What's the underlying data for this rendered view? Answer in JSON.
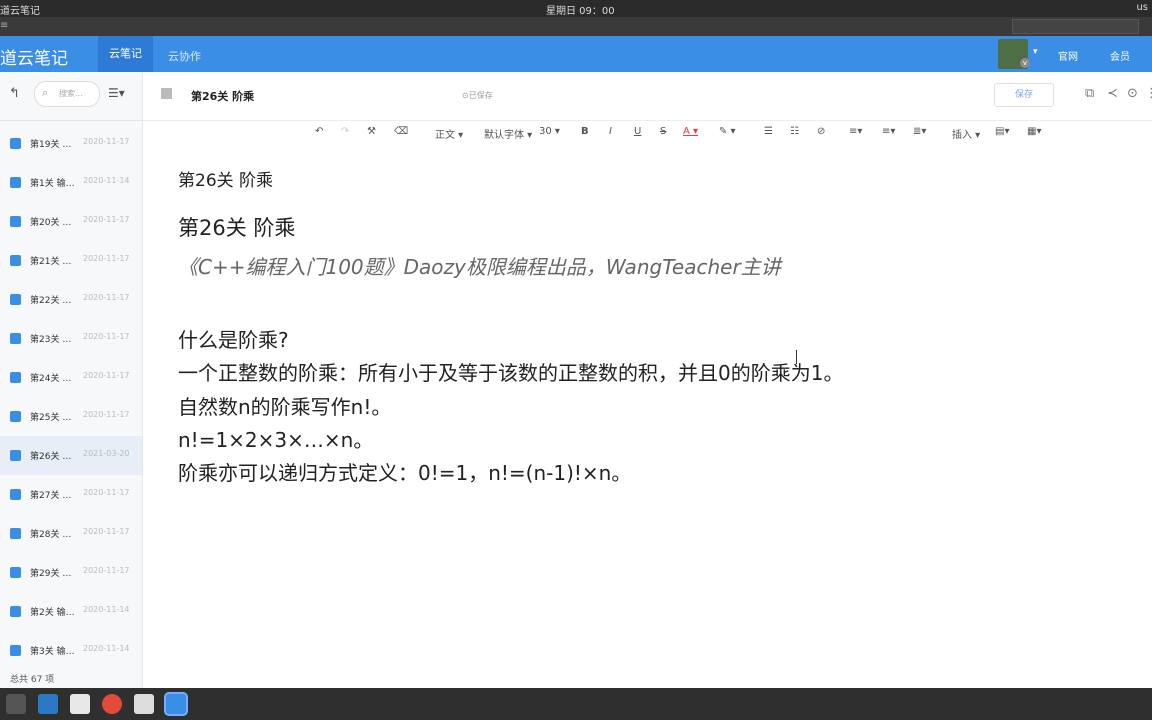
{
  "system": {
    "app_menu": "道云笔记",
    "clock": "星期日 09：00",
    "tray": "us"
  },
  "header": {
    "brand": "道云笔记",
    "tabs": [
      {
        "label": "云笔记"
      },
      {
        "label": "云协作"
      }
    ],
    "links": [
      "官网",
      "会员"
    ],
    "avatar_badge": "v",
    "colors": {
      "bar": "#3a8ee6",
      "active_tab": "#2d7bd6"
    }
  },
  "sidebar": {
    "search_placeholder": "搜索...",
    "notes": [
      {
        "title": "第19关 …",
        "date": "2020-11-17",
        "active": false
      },
      {
        "title": "第1关 输…",
        "date": "2020-11-14",
        "active": false
      },
      {
        "title": "第20关 …",
        "date": "2020-11-17",
        "active": false
      },
      {
        "title": "第21关 …",
        "date": "2020-11-17",
        "active": false
      },
      {
        "title": "第22关 …",
        "date": "2020-11-17",
        "active": false
      },
      {
        "title": "第23关 …",
        "date": "2020-11-17",
        "active": false
      },
      {
        "title": "第24关 …",
        "date": "2020-11-17",
        "active": false
      },
      {
        "title": "第25关 …",
        "date": "2020-11-17",
        "active": false
      },
      {
        "title": "第26关 …",
        "date": "2021-03-20",
        "active": true
      },
      {
        "title": "第27关 …",
        "date": "2020-11-17",
        "active": false
      },
      {
        "title": "第28关 …",
        "date": "2020-11-17",
        "active": false
      },
      {
        "title": "第29关 …",
        "date": "2020-11-17",
        "active": false
      },
      {
        "title": "第2关 输…",
        "date": "2020-11-14",
        "active": false
      },
      {
        "title": "第3关 输…",
        "date": "2020-11-14",
        "active": false
      }
    ],
    "total": "总共 67 项"
  },
  "editor": {
    "doc_title": "第26关 阶乘",
    "saved_status": "已保存",
    "save_button": "保存",
    "toolbar": {
      "style": "正文",
      "font": "默认字体",
      "size": "30",
      "insert": "插入"
    },
    "content": {
      "heading_small": "第26关 阶乘",
      "heading": "第26关 阶乘",
      "subtitle": "《C++编程入门100题》Daozy极限编程出品，WangTeacher主讲",
      "lines": [
        "什么是阶乘?",
        "一个正整数的阶乘：所有小于及等于该数的正整数的积，并且0的阶乘为1。",
        "自然数n的阶乘写作n!。",
        "n!=1×2×3×…×n。",
        "阶乘亦可以递归方式定义：0!=1，n!=(n-1)!×n。"
      ]
    }
  }
}
